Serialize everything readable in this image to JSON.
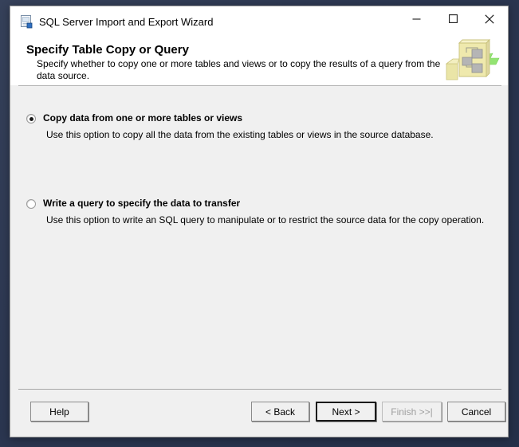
{
  "window": {
    "title": "SQL Server Import and Export Wizard",
    "icon": "wizard-document-icon",
    "controls": {
      "minimize": "minimize-icon",
      "maximize": "maximize-icon",
      "close": "close-icon"
    }
  },
  "header": {
    "title": "Specify Table Copy or Query",
    "description": "Specify whether to copy one or more tables and views or to copy the results of a query from the data source.",
    "graphic": "tables-and-arrow-banner-icon"
  },
  "options": [
    {
      "label": "Copy data from one or more tables or views",
      "description": "Use this option to copy all the data from the existing tables or views in the source database.",
      "selected": true
    },
    {
      "label": "Write a query to specify the data to transfer",
      "description": "Use this option to write an SQL query to manipulate or to restrict the source data for the copy operation.",
      "selected": false
    }
  ],
  "footer": {
    "help": "Help",
    "back": "< Back",
    "next": "Next >",
    "finish": "Finish >>|",
    "cancel": "Cancel",
    "finish_disabled": true,
    "default_button": "Next >"
  },
  "colors": {
    "desktop": "#2e3a53",
    "window_face": "#f0f0f0",
    "header_face": "#ffffff",
    "accent_green": "#8ae06a",
    "banner_yellow": "#efeaa8"
  }
}
